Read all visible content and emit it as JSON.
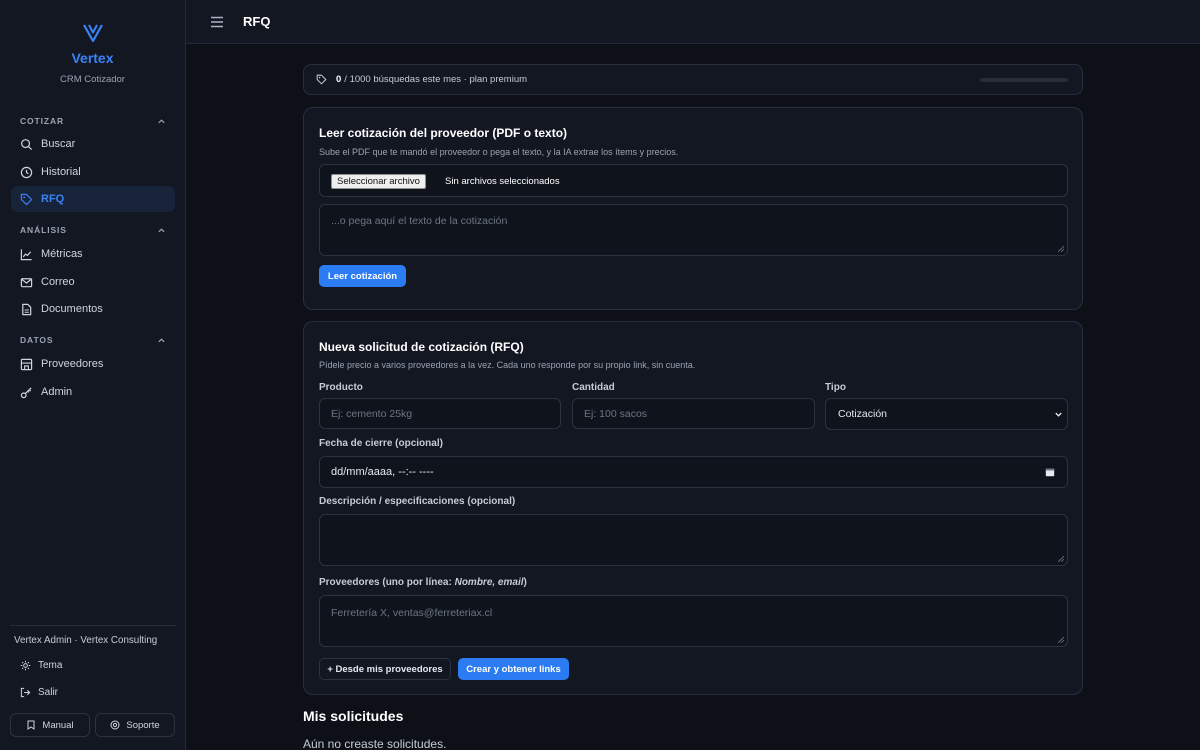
{
  "brand": {
    "name": "Vertex",
    "subtitle": "CRM Cotizador",
    "accent": "#3b82f6"
  },
  "sidebar": {
    "sections": [
      {
        "title": "COTIZAR",
        "items": [
          {
            "label": "Buscar",
            "icon": "search-icon"
          },
          {
            "label": "Historial",
            "icon": "clock-icon"
          },
          {
            "label": "RFQ",
            "icon": "tag-icon",
            "active": true
          }
        ]
      },
      {
        "title": "ANÁLISIS",
        "items": [
          {
            "label": "Métricas",
            "icon": "chart-icon"
          },
          {
            "label": "Correo",
            "icon": "mail-icon"
          },
          {
            "label": "Documentos",
            "icon": "document-icon"
          }
        ]
      },
      {
        "title": "DATOS",
        "items": [
          {
            "label": "Proveedores",
            "icon": "store-icon"
          },
          {
            "label": "Admin",
            "icon": "key-icon"
          }
        ]
      }
    ],
    "user": "Vertex Admin · Vertex Consulting",
    "theme_label": "Tema",
    "logout_label": "Salir",
    "manual_label": "Manual",
    "support_label": "Soporte"
  },
  "topbar": {
    "title": "RFQ"
  },
  "usage": {
    "used": "0",
    "rest": "/ 1000 búsquedas este mes · plan premium",
    "fraction": 0
  },
  "read_card": {
    "title": "Leer cotización del proveedor (PDF o texto)",
    "subtitle": "Sube el PDF que te mandó el proveedor o pega el texto, y la IA extrae los ítems y precios.",
    "file_button": "Seleccionar archivo",
    "file_status": "Sin archivos seleccionados",
    "text_placeholder": "...o pega aquí el texto de la cotización",
    "submit_label": "Leer cotización"
  },
  "rfq_card": {
    "title": "Nueva solicitud de cotización (RFQ)",
    "subtitle": "Pídele precio a varios proveedores a la vez. Cada uno responde por su propio link, sin cuenta.",
    "product_label": "Producto",
    "product_placeholder": "Ej: cemento 25kg",
    "quantity_label": "Cantidad",
    "quantity_placeholder": "Ej: 100 sacos",
    "type_label": "Tipo",
    "type_value": "Cotización",
    "date_label": "Fecha de cierre (opcional)",
    "date_value": "dd/mm/aaaa, --:-- ----",
    "description_label": "Descripción / especificaciones (opcional)",
    "suppliers_label_prefix": "Proveedores (uno por línea: ",
    "suppliers_label_em": "Nombre, email",
    "suppliers_label_suffix": ")",
    "suppliers_placeholder": "Ferretería X, ventas@ferreteriax.cl",
    "from_suppliers_label": "+ Desde mis proveedores",
    "create_label": "Crear y obtener links"
  },
  "requests": {
    "title": "Mis solicitudes",
    "empty": "Aún no creaste solicitudes."
  }
}
